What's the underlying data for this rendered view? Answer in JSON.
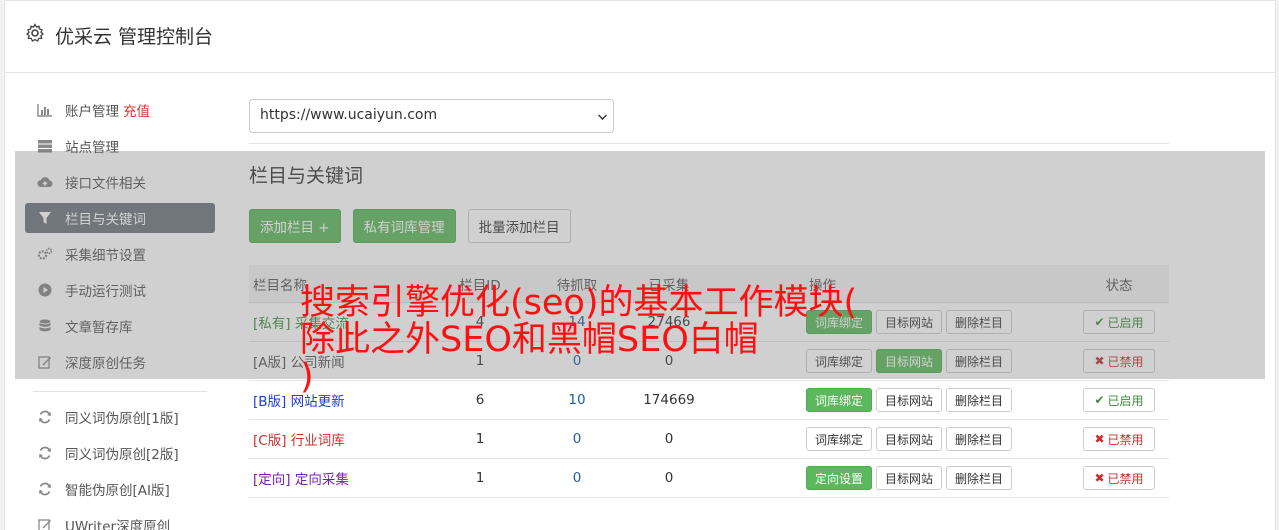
{
  "header": {
    "title": "优采云 管理控制台",
    "icon": "gear-icon"
  },
  "sidebar": {
    "items": [
      {
        "label": "账户管理",
        "extra": "充值",
        "icon": "bar-chart-icon"
      },
      {
        "label": "站点管理",
        "icon": "server-icon"
      },
      {
        "label": "接口文件相关",
        "icon": "cloud-upload-icon"
      },
      {
        "label": "栏目与关键词",
        "icon": "filter-icon"
      },
      {
        "label": "采集细节设置",
        "icon": "cogs-icon"
      },
      {
        "label": "手动运行测试",
        "icon": "play-circle-icon"
      },
      {
        "label": "文章暂存库",
        "icon": "database-icon"
      },
      {
        "label": "深度原创任务",
        "icon": "edit-icon"
      }
    ],
    "items2": [
      {
        "label": "同义词伪原创[1版]",
        "icon": "refresh-icon"
      },
      {
        "label": "同义词伪原创[2版]",
        "icon": "refresh-icon"
      },
      {
        "label": "智能伪原创[AI版]",
        "icon": "refresh-icon"
      },
      {
        "label": "UWriter深度原创",
        "icon": "edit-icon"
      }
    ]
  },
  "main": {
    "site_select": "https://www.ucaiyun.com",
    "section_title": "栏目与关键词",
    "buttons": {
      "add": "添加栏目 +",
      "private_lib": "私有词库管理",
      "batch_add": "批量添加栏目"
    },
    "table": {
      "headers": {
        "name": "栏目名称",
        "id": "栏目ID",
        "pending": "待抓取",
        "collected": "已采集",
        "ops": "操作",
        "status": "状态"
      },
      "rows": [
        {
          "tag": "[私有]",
          "name": "采集交流",
          "id": "4",
          "pending": "14",
          "collected": "27466",
          "op1": "词库绑定",
          "op2": "目标网站",
          "op3": "删除栏目",
          "status": "已启用"
        },
        {
          "tag": "[A版]",
          "name": "公司新闻",
          "id": "1",
          "pending": "0",
          "collected": "0",
          "op1": "词库绑定",
          "op2": "目标网站",
          "op3": "删除栏目",
          "status": "已禁用"
        },
        {
          "tag": "[B版]",
          "name": "网站更新",
          "id": "6",
          "pending": "10",
          "collected": "174669",
          "op1": "词库绑定",
          "op2": "目标网站",
          "op3": "删除栏目",
          "status": "已启用"
        },
        {
          "tag": "[C版]",
          "name": "行业词库",
          "id": "1",
          "pending": "0",
          "collected": "0",
          "op1": "词库绑定",
          "op2": "目标网站",
          "op3": "删除栏目",
          "status": "已禁用"
        },
        {
          "tag": "[定向]",
          "name": "定向采集",
          "id": "1",
          "pending": "0",
          "collected": "0",
          "op1": "定向设置",
          "op2": "目标网站",
          "op3": "删除栏目",
          "status": "已禁用"
        }
      ]
    }
  },
  "overlay_text": {
    "line1": "搜索引擎优化(seo)的基本工作模块(",
    "line2": "除此之外SEO和黑帽SEO白帽",
    "line3": ")"
  },
  "colors": {
    "green": "#5cb85c",
    "active_nav": "#6c757d",
    "red_text": "#ff1010"
  }
}
